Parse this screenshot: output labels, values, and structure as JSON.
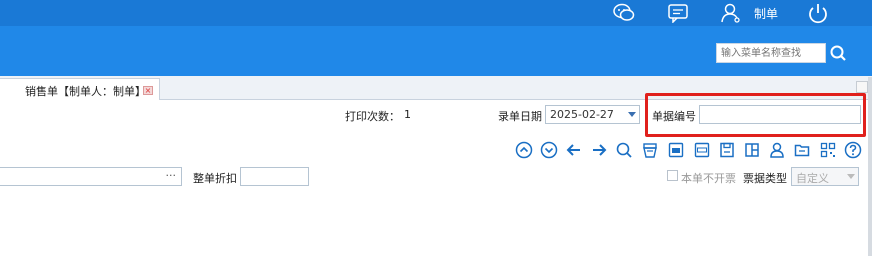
{
  "topbar": {
    "icons": [
      "wechat-icon",
      "message-icon",
      "user-icon",
      "power-icon"
    ],
    "user_name": "制单",
    "color": "#1a79d6"
  },
  "search": {
    "placeholder": "输入菜单名称查找"
  },
  "tabs": [
    {
      "label": "销售单【制单人：制单】",
      "close_icon": "close-icon"
    }
  ],
  "form": {
    "print_count_label": "打印次数：",
    "print_count_value": "1",
    "entry_date_label": "录单日期",
    "entry_date_value": "2025-02-27",
    "doc_number_label": "单据编号",
    "doc_number_value": "",
    "ellipsis": "···",
    "discount_label": "整单折扣",
    "discount_value": "",
    "no_invoice_label": "本单不开票",
    "invoice_type_label": "票据类型",
    "invoice_type_value": "自定义"
  },
  "toolbar": {
    "icons": [
      "up-circle-icon",
      "down-circle-icon",
      "arrow-left-icon",
      "arrow-right-icon",
      "search-icon",
      "print-icon",
      "tag-icon",
      "export-icon",
      "save-icon",
      "copy-icon",
      "user-icon",
      "folder-icon",
      "qrcode-icon",
      "help-icon"
    ]
  },
  "colors": {
    "accent": "#1a79d6",
    "header": "#2088e8",
    "highlight": "#e0201c",
    "icon_blue": "#1a6fc4"
  }
}
